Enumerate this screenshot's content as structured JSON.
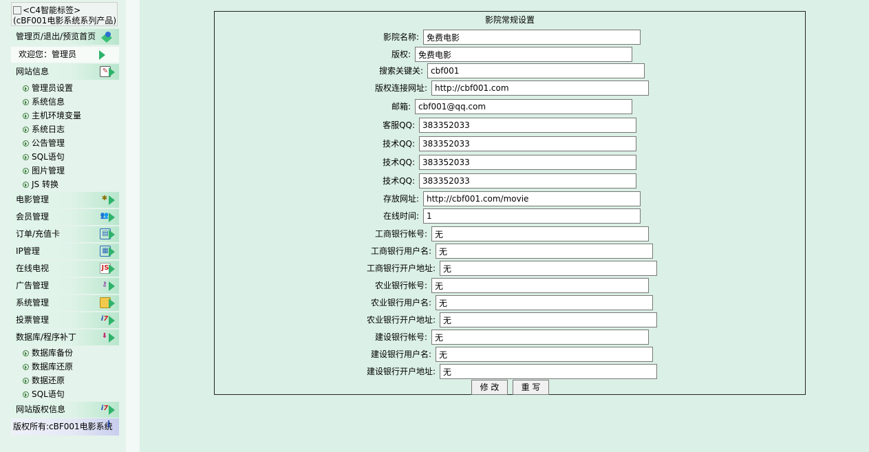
{
  "sidebar": {
    "logo_alt": "<C4智能标签>",
    "logo_sub": "(cBF001电影系统系列产品)",
    "top_link": "管理页/退出/预览首页",
    "welcome": "欢迎您：管理员",
    "groups": [
      {
        "label": "网站信息",
        "icon": "note-icon"
      },
      {
        "label": "电影管理",
        "icon": "film-icon"
      },
      {
        "label": "会员管理",
        "icon": "users-icon"
      },
      {
        "label": "订单/充值卡",
        "icon": "card-icon"
      },
      {
        "label": "IP管理",
        "icon": "grid-icon"
      },
      {
        "label": "在线电视",
        "icon": "js-icon"
      },
      {
        "label": "广告管理",
        "icon": "key-icon"
      },
      {
        "label": "系统管理",
        "icon": "folder-icon"
      },
      {
        "label": "投票管理",
        "icon": "vote-icon"
      },
      {
        "label": "数据库/程序补丁",
        "icon": "download-icon"
      },
      {
        "label": "网站版权信息",
        "icon": "vote-icon"
      }
    ],
    "site_items": [
      "管理员设置",
      "系统信息",
      "主机环境变量",
      "系统日志",
      "公告管理",
      "SQL语句",
      "图片管理",
      "JS 转换"
    ],
    "db_items": [
      "数据库备份",
      "数据库还原",
      "数据还原",
      "SQL语句"
    ],
    "copyright": "版权所有:cBF001电影系统"
  },
  "form": {
    "title": "影院常规设置",
    "fields": [
      {
        "label": "影院名称:",
        "value": "免费电影"
      },
      {
        "label": "版权:",
        "value": "免费电影"
      },
      {
        "label": "搜索关键关:",
        "value": "cbf001"
      },
      {
        "label": "版权连接网址:",
        "value": "http://cbf001.com"
      },
      {
        "label": "邮箱:",
        "value": "cbf001@qq.com"
      },
      {
        "label": "客服QQ:",
        "value": "383352033"
      },
      {
        "label": "技术QQ:",
        "value": "383352033"
      },
      {
        "label": "技术QQ:",
        "value": "383352033"
      },
      {
        "label": "技术QQ:",
        "value": "383352033"
      },
      {
        "label": "存放网址:",
        "value": "http://cbf001.com/movie"
      },
      {
        "label": "在线时间:",
        "value": "1"
      },
      {
        "label": "工商银行帐号:",
        "value": "无"
      },
      {
        "label": "工商银行用户名:",
        "value": "无"
      },
      {
        "label": "工商银行开户地址:",
        "value": "无"
      },
      {
        "label": "农业银行帐号:",
        "value": "无"
      },
      {
        "label": "农业银行用户名:",
        "value": "无"
      },
      {
        "label": "农业银行开户地址:",
        "value": "无"
      },
      {
        "label": "建设银行帐号:",
        "value": "无"
      },
      {
        "label": "建设银行用户名:",
        "value": "无"
      },
      {
        "label": "建设银行开户地址:",
        "value": "无"
      }
    ],
    "submit_label": "修 改",
    "reset_label": "重 写"
  }
}
